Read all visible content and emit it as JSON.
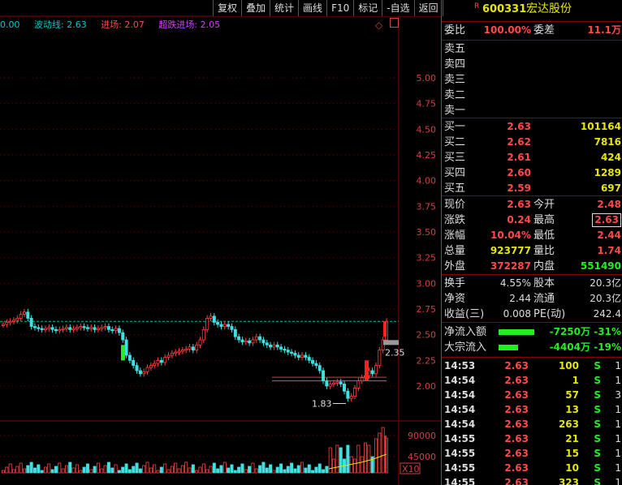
{
  "toolbar": {
    "items": [
      "复权",
      "叠加",
      "统计",
      "画线",
      "F10",
      "标记",
      "-自选",
      "返回"
    ]
  },
  "indicators": {
    "first": "0.00",
    "wave_label": "波动线",
    "wave_value": "2.63",
    "entry_label": "进场",
    "entry_value": "2.07",
    "oversold_label": "超跌进场",
    "oversold_value": "2.05"
  },
  "chart_labels": {
    "last_price": "2.35",
    "low_label": "1.83",
    "volume_multiplier": "X10"
  },
  "price_axis": [
    "5.00",
    "4.75",
    "4.50",
    "4.25",
    "4.00",
    "3.75",
    "3.50",
    "3.25",
    "3.00",
    "2.75",
    "2.50",
    "2.25",
    "2.00"
  ],
  "volume_axis": [
    "90000",
    "45000"
  ],
  "stock": {
    "r_mark": "R",
    "code": "600331",
    "name": "宏达股份"
  },
  "ratio": {
    "label1": "委比",
    "value1": "100.00%",
    "label2": "委差",
    "value2": "11.1万"
  },
  "asks": [
    {
      "label": "卖五"
    },
    {
      "label": "卖四"
    },
    {
      "label": "卖三"
    },
    {
      "label": "卖二"
    },
    {
      "label": "卖一"
    }
  ],
  "bids": [
    {
      "label": "买一",
      "price": "2.63",
      "vol": "101164"
    },
    {
      "label": "买二",
      "price": "2.62",
      "vol": "7816"
    },
    {
      "label": "买三",
      "price": "2.61",
      "vol": "424"
    },
    {
      "label": "买四",
      "price": "2.60",
      "vol": "1289"
    },
    {
      "label": "买五",
      "price": "2.59",
      "vol": "697"
    }
  ],
  "stats": [
    {
      "l1": "现价",
      "v1": "2.63",
      "c1": "red",
      "l2": "今开",
      "v2": "2.48",
      "c2": "red"
    },
    {
      "l1": "涨跌",
      "v1": "0.24",
      "c1": "red",
      "l2": "最高",
      "v2": "2.63",
      "c2": "red"
    },
    {
      "l1": "涨幅",
      "v1": "10.04%",
      "c1": "red",
      "l2": "最低",
      "v2": "2.44",
      "c2": "red"
    },
    {
      "l1": "总量",
      "v1": "923777",
      "c1": "yel",
      "l2": "量比",
      "v2": "1.74",
      "c2": "red"
    },
    {
      "l1": "外盘",
      "v1": "372287",
      "c1": "red",
      "l2": "内盘",
      "v2": "551490",
      "c2": "grn"
    }
  ],
  "stats2": [
    {
      "l1": "换手",
      "v1": "4.55%",
      "l2": "股本",
      "v2": "20.3亿"
    },
    {
      "l1": "净资",
      "v1": "2.44",
      "l2": "流通",
      "v2": "20.3亿"
    },
    {
      "l1": "收益(三)",
      "v1": "0.008",
      "l2": "PE(动)",
      "v2": "242.4"
    }
  ],
  "flows": [
    {
      "label": "净流入额",
      "value": "-7250万",
      "pct": "-31%",
      "bar": 1.0
    },
    {
      "label": "大宗流入",
      "value": "-4404万",
      "pct": "-19%",
      "bar": 0.55
    }
  ],
  "ticks": [
    {
      "time": "14:53",
      "price": "2.63",
      "vol": "100",
      "side": "S",
      "n": "1"
    },
    {
      "time": "14:54",
      "price": "2.63",
      "vol": "1",
      "side": "S",
      "n": "1"
    },
    {
      "time": "14:54",
      "price": "2.63",
      "vol": "57",
      "side": "S",
      "n": "3"
    },
    {
      "time": "14:54",
      "price": "2.63",
      "vol": "13",
      "side": "S",
      "n": "1"
    },
    {
      "time": "14:54",
      "price": "2.63",
      "vol": "263",
      "side": "S",
      "n": "1"
    },
    {
      "time": "14:55",
      "price": "2.63",
      "vol": "21",
      "side": "S",
      "n": "1"
    },
    {
      "time": "14:55",
      "price": "2.63",
      "vol": "15",
      "side": "S",
      "n": "1"
    },
    {
      "time": "14:55",
      "price": "2.63",
      "vol": "10",
      "side": "S",
      "n": "1"
    },
    {
      "time": "14:55",
      "price": "2.63",
      "vol": "323",
      "side": "S",
      "n": "1"
    }
  ]
}
